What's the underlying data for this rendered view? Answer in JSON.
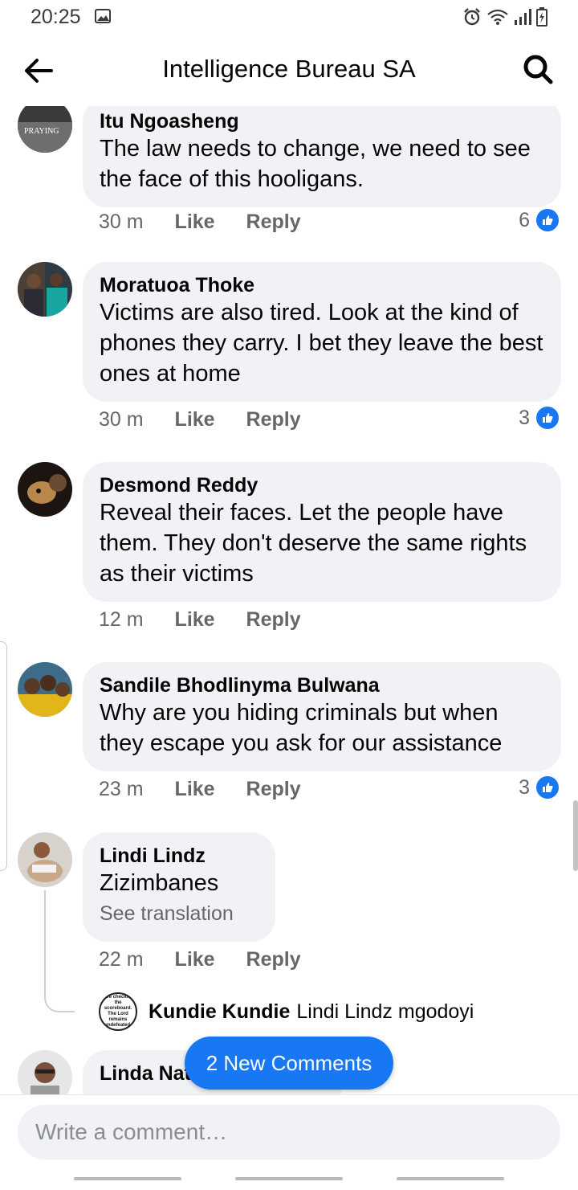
{
  "status_bar": {
    "time": "20:25"
  },
  "header": {
    "title": "Intelligence Bureau SA"
  },
  "comments": [
    {
      "author": "Itu Ngoasheng",
      "text": "The law needs to change, we need to see the face of this hooligans.",
      "time": "30 m",
      "like_label": "Like",
      "reply_label": "Reply",
      "reactions": "6"
    },
    {
      "author": "Moratuoa Thoke",
      "text": "Victims are also tired. Look at the kind of phones they carry. I bet they leave the best ones at home",
      "time": "30 m",
      "like_label": "Like",
      "reply_label": "Reply",
      "reactions": "3"
    },
    {
      "author": "Desmond Reddy",
      "text": "Reveal their faces. Let the people have them. They don't deserve the same rights as their victims",
      "time": "12 m",
      "like_label": "Like",
      "reply_label": "Reply"
    },
    {
      "author": "Sandile Bhodlinyma Bulwana",
      "text": "Why are you hiding criminals but when they escape you ask for our assistance",
      "time": "23 m",
      "like_label": "Like",
      "reply_label": "Reply",
      "reactions": "3"
    },
    {
      "author": "Lindi Lindz",
      "text": "Zizimbanes",
      "see_translation": "See translation",
      "time": "22 m",
      "like_label": "Like",
      "reply_label": "Reply",
      "reply_preview": {
        "author": "Kundie Kundie",
        "text": "Lindi Lindz mgodoyi",
        "avatar_text": "I've checked the scoreboard. The Lord remains undefeated."
      }
    },
    {
      "author": "Linda Nat"
    }
  ],
  "new_comments_label": "2 New Comments",
  "composer": {
    "placeholder": "Write a comment…"
  }
}
